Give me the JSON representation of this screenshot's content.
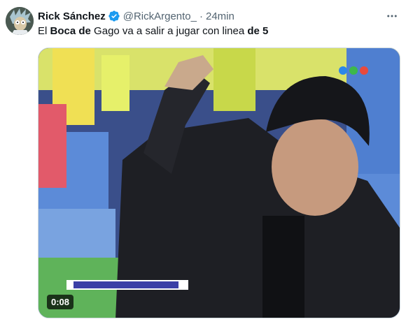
{
  "tweet": {
    "author_name": "Rick Sánchez",
    "handle": "@RickArgento_",
    "separator": "·",
    "time_ago": "24min",
    "verified_icon": "verified-badge-icon",
    "more_icon": "more-options-icon",
    "text_parts": [
      {
        "text": "El ",
        "bold": false
      },
      {
        "text": "Boca",
        "bold": true
      },
      {
        "text": " ",
        "bold": false
      },
      {
        "text": "de",
        "bold": true
      },
      {
        "text": " Gago va a salir a jugar con linea ",
        "bold": false
      },
      {
        "text": "de 5",
        "bold": true
      }
    ]
  },
  "media": {
    "type": "video",
    "duration": "0:08"
  },
  "colors": {
    "verified_blue": "#1d9bf0",
    "secondary_text": "#536471",
    "primary_text": "#0f1419"
  }
}
